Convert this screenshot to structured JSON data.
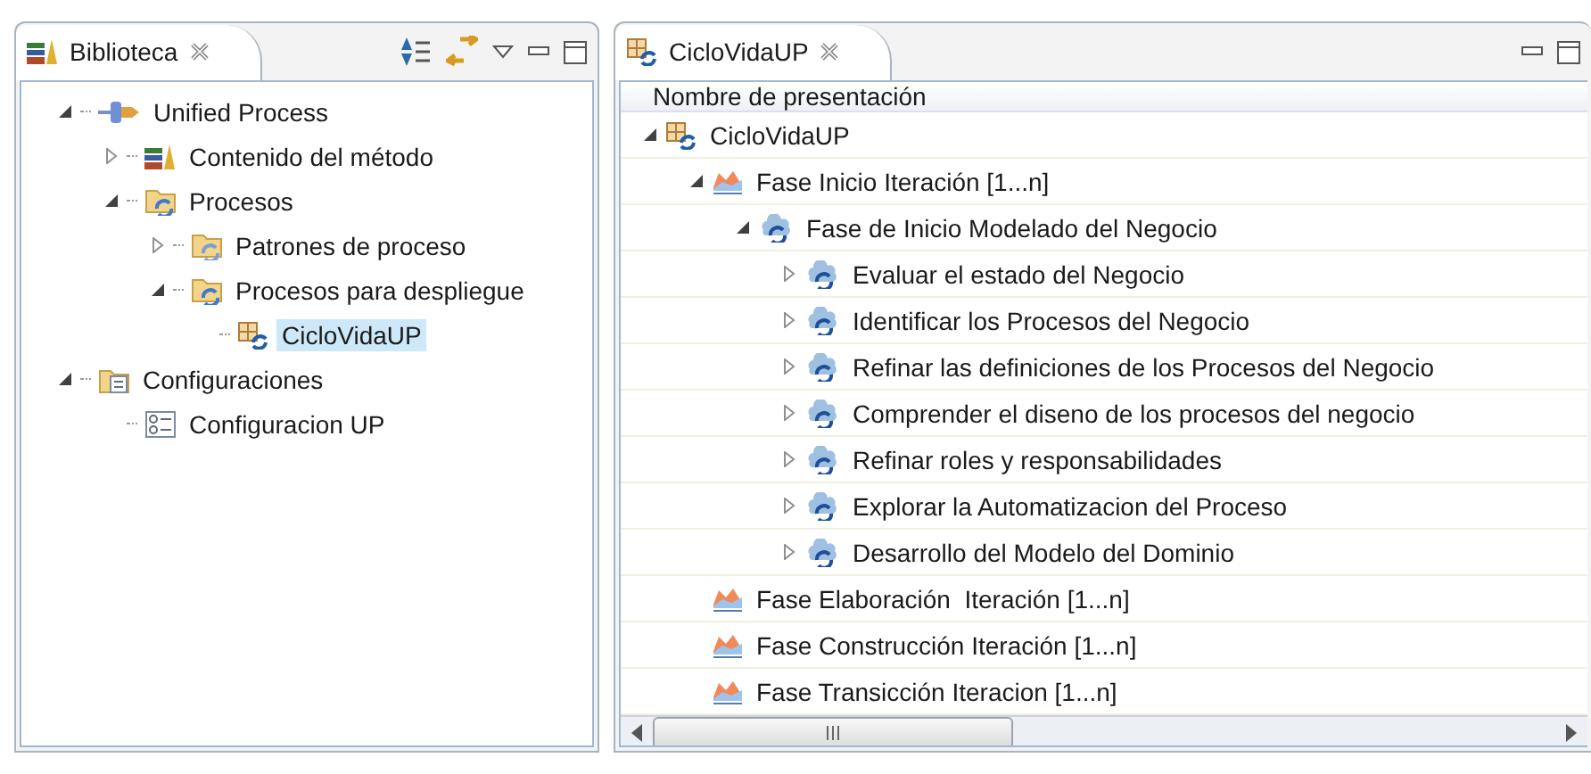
{
  "library_view": {
    "tab": {
      "title": "Biblioteca",
      "selected": true
    },
    "tree": [
      {
        "label": "Unified Process",
        "kind": "plugin",
        "expanded": true,
        "selected": false,
        "children": [
          {
            "label": "Contenido del método",
            "kind": "library",
            "expanded": false,
            "selected": false
          },
          {
            "label": "Procesos",
            "kind": "processfolder",
            "expanded": true,
            "selected": false,
            "children": [
              {
                "label": "Patrones de proceso",
                "kind": "patternfolder",
                "expanded": false,
                "selected": false
              },
              {
                "label": "Procesos para despliegue",
                "kind": "deployfolder",
                "expanded": true,
                "selected": false,
                "children": [
                  {
                    "label": "CicloVidaUP",
                    "kind": "deploy",
                    "selected": true
                  }
                ]
              }
            ]
          }
        ]
      },
      {
        "label": "Configuraciones",
        "kind": "configfolder",
        "expanded": true,
        "selected": false,
        "children": [
          {
            "label": "Configuracion UP",
            "kind": "config"
          }
        ]
      }
    ]
  },
  "editor": {
    "tab": {
      "title": "CicloVidaUP",
      "selected": true
    },
    "column_header": "Nombre de presentación",
    "tree": [
      {
        "label": "CicloVidaUP",
        "kind": "deploy",
        "expanded": true,
        "children": [
          {
            "label": "Fase Inicio Iteración [1...n]",
            "kind": "phase",
            "expanded": true,
            "children": [
              {
                "label": "Fase de Inicio Modelado del Negocio",
                "kind": "activity",
                "expanded": true,
                "children": [
                  {
                    "label": "Evaluar el estado del Negocio",
                    "kind": "activity",
                    "expanded": false
                  },
                  {
                    "label": "Identificar los Procesos del Negocio",
                    "kind": "activity",
                    "expanded": false
                  },
                  {
                    "label": "Refinar las definiciones de los Procesos del Negocio",
                    "kind": "activity",
                    "expanded": false
                  },
                  {
                    "label": "Comprender el diseno de los procesos del negocio",
                    "kind": "activity",
                    "expanded": false
                  },
                  {
                    "label": "Refinar roles y responsabilidades",
                    "kind": "activity",
                    "expanded": false
                  },
                  {
                    "label": "Explorar la Automatizacion del Proceso",
                    "kind": "activity",
                    "expanded": false
                  },
                  {
                    "label": "Desarrollo del Modelo del Dominio",
                    "kind": "activity",
                    "expanded": false
                  }
                ]
              }
            ]
          },
          {
            "label": "Fase Elaboración  Iteración [1...n]",
            "kind": "phase"
          },
          {
            "label": "Fase Construcción Iteración [1...n]",
            "kind": "phase"
          },
          {
            "label": "Fase Transicción Iteracion [1...n]",
            "kind": "phase"
          }
        ]
      }
    ]
  }
}
